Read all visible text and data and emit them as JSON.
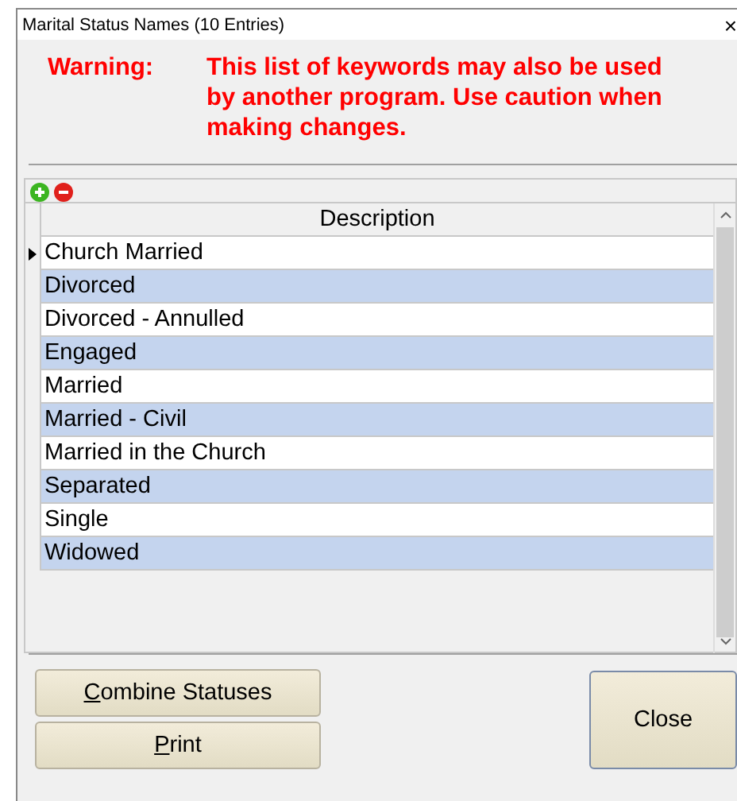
{
  "window": {
    "title": "Marital Status Names (10 Entries)",
    "close": "×"
  },
  "warning": {
    "label": "Warning:",
    "text": "This list of keywords may also be used by another program. Use caution when making changes."
  },
  "grid": {
    "column": "Description",
    "rows": [
      {
        "text": "Church Married",
        "current": true
      },
      {
        "text": "Divorced",
        "current": false
      },
      {
        "text": "Divorced - Annulled",
        "current": false
      },
      {
        "text": "Engaged",
        "current": false
      },
      {
        "text": "Married",
        "current": false
      },
      {
        "text": "Married - Civil",
        "current": false
      },
      {
        "text": "Married in the Church",
        "current": false
      },
      {
        "text": "Separated",
        "current": false
      },
      {
        "text": "Single",
        "current": false
      },
      {
        "text": "Widowed",
        "current": false
      }
    ]
  },
  "buttons": {
    "left": [
      "Combine Statuses",
      "Print"
    ],
    "close": "Close"
  }
}
